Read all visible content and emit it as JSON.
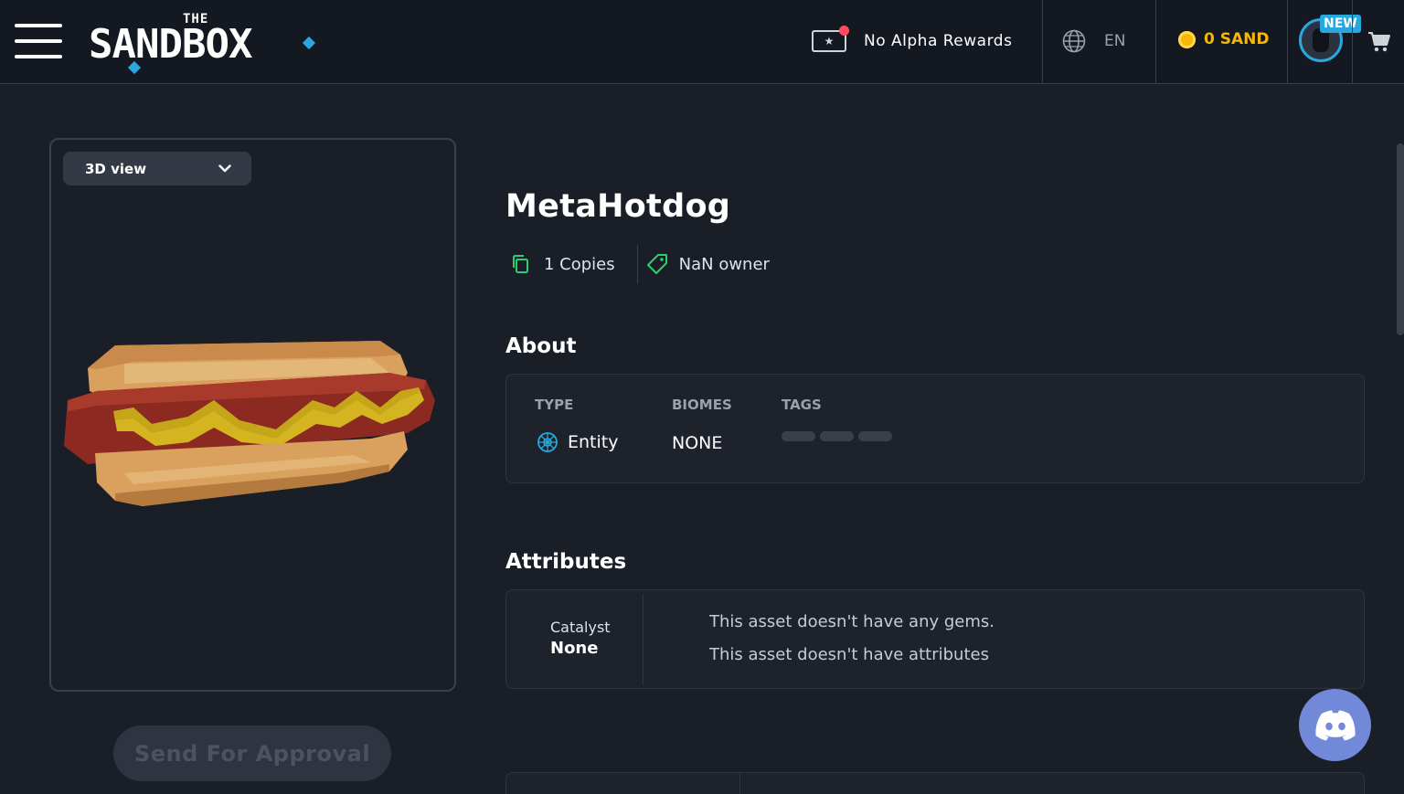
{
  "header": {
    "logo_the": "THE",
    "logo_word": "SANDBOX",
    "rewards_label": "No Alpha Rewards",
    "language": "EN",
    "sand_balance": "0 SAND",
    "new_badge": "NEW"
  },
  "viewer": {
    "view_mode": "3D view",
    "send_button": "Send For Approval"
  },
  "asset": {
    "title": "MetaHotdog",
    "copies": "1 Copies",
    "owners": "NaN owner"
  },
  "about": {
    "section_title": "About",
    "type_label": "TYPE",
    "type_value": "Entity",
    "biomes_label": "BIOMES",
    "biomes_value": "NONE",
    "tags_label": "TAGS"
  },
  "attributes": {
    "section_title": "Attributes",
    "catalyst_label": "Catalyst",
    "catalyst_value": "None",
    "gems_text": "This asset doesn't have any gems.",
    "attributes_text": "This asset doesn't have attributes"
  },
  "colors": {
    "accent_blue": "#29a8e0",
    "sand_gold": "#f5b70a",
    "green_icon": "#2ecc71",
    "discord": "#7289da"
  },
  "icons": [
    "menu-icon",
    "ticket-icon",
    "globe-icon",
    "sand-coin-icon",
    "cart-icon",
    "chevron-down-icon",
    "copies-icon",
    "tag-icon",
    "entity-icon",
    "discord-icon"
  ]
}
